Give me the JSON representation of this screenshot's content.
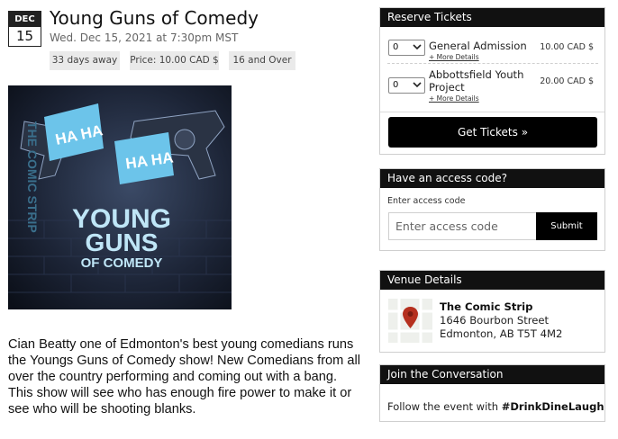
{
  "event": {
    "month": "DEC",
    "day": "15",
    "title": "Young Guns of Comedy",
    "datetime": "Wed. Dec 15, 2021 at 7:30pm MST",
    "badges": {
      "days_away": "33 days away",
      "price": "Price: 10.00 CAD $",
      "age": "16 and Over"
    },
    "poster": {
      "side_text": "THE COMIC STRIP",
      "haha_1": "HA HA",
      "haha_2": "HA HA",
      "line_1": "YOUNG",
      "line_2": "GUNS",
      "line_3": "OF COMEDY"
    },
    "description": "Cian Beatty one of Edmonton's best young comedians runs the Youngs Guns of Comedy show! New Comedians from all over the country performing and coming out with a bang. This show will see who has enough fire power to make it or see who will be shooting blanks."
  },
  "reserve": {
    "header": "Reserve Tickets",
    "tickets": [
      {
        "qty": "0",
        "name": "General Admission",
        "more": "+ More Details",
        "price": "10.00 CAD $"
      },
      {
        "qty": "0",
        "name": "Abbottsfield Youth Project",
        "more": "+ More Details",
        "price": "20.00 CAD $"
      }
    ],
    "button": "Get Tickets »"
  },
  "access": {
    "header": "Have an access code?",
    "label": "Enter access code",
    "placeholder": "Enter access code",
    "submit": "Submit"
  },
  "venue": {
    "header": "Venue Details",
    "name": "The Comic Strip",
    "address_1": "1646 Bourbon Street",
    "address_2": "Edmonton, AB T5T 4M2"
  },
  "social": {
    "header": "Join the Conversation",
    "text": "Follow the event with",
    "hashtag": "#DrinkDineLaugh"
  },
  "colors": {
    "accent": "#000000",
    "badge_bg": "#eaeaea",
    "map_pin": "#b5301f",
    "poster_bg": "#1c2436",
    "poster_title": "#bfe6f7"
  },
  "icons": {
    "qty_select": "chevron-down-icon",
    "venue": "map-pin-icon"
  }
}
